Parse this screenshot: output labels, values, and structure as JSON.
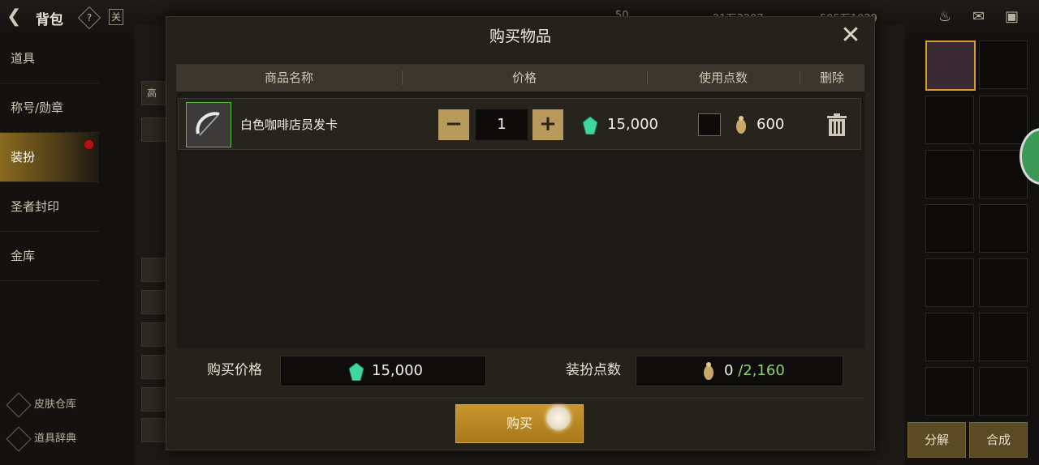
{
  "topbar": {
    "title": "背包",
    "help": "?",
    "lock": "关",
    "currency1": "50",
    "currency2": "21万3207",
    "currency3": "505万1029"
  },
  "sidebar": {
    "items": [
      {
        "label": "道具"
      },
      {
        "label": "称号/勋章"
      },
      {
        "label": "装扮"
      },
      {
        "label": "圣者封印"
      },
      {
        "label": "金库"
      }
    ],
    "bottom": [
      {
        "label": "皮肤仓库"
      },
      {
        "label": "道具辞典"
      }
    ]
  },
  "background": {
    "tab_label": "高",
    "decompose": "分解",
    "combine": "合成"
  },
  "dialog": {
    "title": "购买物品",
    "columns": [
      "商品名称",
      "价格",
      "使用点数",
      "删除"
    ],
    "item": {
      "name": "白色咖啡店员发卡",
      "quantity": "1",
      "price": "15,000",
      "points": "600"
    },
    "footer": {
      "price_label": "购买价格",
      "price_value": "15,000",
      "points_label": "装扮点数",
      "points_used": "0",
      "points_total": "/2,160"
    },
    "buy_label": "购买",
    "close": "✕"
  },
  "colors": {
    "accent": "#c9962a",
    "green_text": "#8ed36a",
    "gem": "#3fd7a0"
  }
}
